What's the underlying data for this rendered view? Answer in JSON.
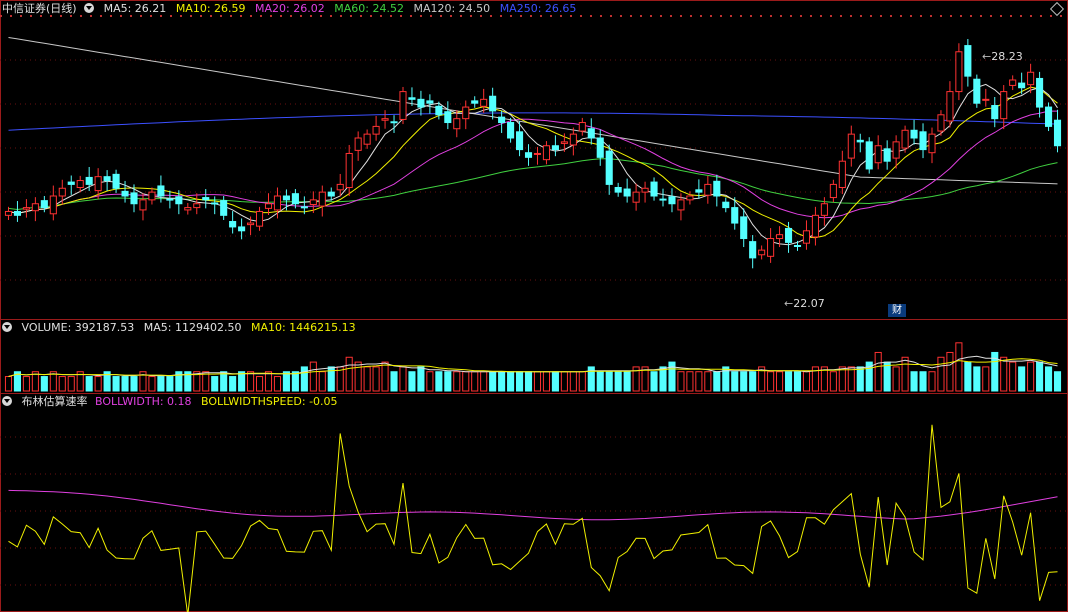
{
  "main_panel": {
    "title": "中信证券(日线)",
    "ma_labels": [
      {
        "text": "MA5: 26.21",
        "color": "#e0e0e0"
      },
      {
        "text": "MA10: 26.59",
        "color": "#f0f000"
      },
      {
        "text": "MA20: 26.02",
        "color": "#e040e0"
      },
      {
        "text": "MA60: 24.52",
        "color": "#40d040"
      },
      {
        "text": "MA120: 24.50",
        "color": "#c8c8c8"
      },
      {
        "text": "MA250: 26.65",
        "color": "#3c50ff"
      }
    ],
    "high_label": "28.23",
    "low_label": "22.07",
    "event_badge": "财"
  },
  "volume_panel": {
    "labels": [
      {
        "text": "VOLUME: 392187.53",
        "color": "#e0e0e0"
      },
      {
        "text": "MA5: 1129402.50",
        "color": "#e0e0e0"
      },
      {
        "text": "MA10: 1446215.13",
        "color": "#f0f000"
      }
    ]
  },
  "indicator_panel": {
    "title": "布林估算速率",
    "labels": [
      {
        "text": "BOLLWIDTH: 0.18",
        "color": "#e040e0"
      },
      {
        "text": "BOLLWIDTHSPEED: -0.05",
        "color": "#f0f000"
      }
    ]
  },
  "colors": {
    "up": "#ff3232",
    "down": "#54ffff",
    "border": "#9b1b1b",
    "ma5": "#e0e0e0",
    "ma10": "#f0f000",
    "ma20": "#e040e0",
    "ma60": "#40d040",
    "ma120": "#c8c8c8",
    "ma250": "#3c50ff"
  },
  "chart_data": [
    {
      "type": "candlestick",
      "title": "中信证券(日线)",
      "x": "trading days (unlabeled)",
      "ylim": [
        21.5,
        29.0
      ],
      "high": 28.23,
      "low": 22.07,
      "close_series": [
        24.1,
        24.0,
        24.2,
        24.3,
        24.2,
        24.5,
        24.7,
        24.8,
        24.9,
        24.8,
        25.0,
        24.9,
        24.7,
        24.5,
        24.3,
        24.4,
        24.6,
        24.5,
        24.4,
        24.3,
        24.2,
        24.3,
        24.4,
        24.3,
        24.0,
        23.7,
        23.6,
        23.8,
        24.1,
        24.3,
        24.5,
        24.4,
        24.3,
        24.2,
        24.4,
        24.6,
        24.5,
        24.8,
        25.6,
        26.0,
        26.1,
        26.3,
        26.5,
        26.4,
        27.2,
        27.0,
        26.8,
        26.9,
        26.6,
        26.4,
        26.5,
        26.8,
        26.9,
        27.0,
        26.7,
        26.4,
        26.0,
        25.7,
        25.5,
        25.6,
        25.8,
        25.7,
        25.9,
        26.1,
        26.4,
        26.0,
        25.5,
        24.8,
        24.6,
        24.5,
        24.6,
        24.7,
        24.5,
        24.4,
        24.3,
        24.4,
        24.5,
        24.6,
        24.8,
        24.5,
        24.2,
        23.8,
        23.4,
        22.9,
        23.1,
        23.4,
        23.5,
        23.3,
        23.2,
        23.6,
        24.0,
        24.3,
        24.8,
        25.4,
        26.1,
        25.9,
        25.2,
        25.8,
        25.4,
        25.9,
        26.2,
        26.0,
        25.7,
        26.1,
        26.6,
        27.2,
        28.23,
        27.6,
        26.9,
        27.0,
        26.5,
        27.2,
        27.5,
        27.3,
        27.7,
        26.8,
        26.3,
        25.8
      ],
      "ma": {
        "MA5": 26.21,
        "MA10": 26.59,
        "MA20": 26.02,
        "MA60": 24.52,
        "MA120": 24.5,
        "MA250": 26.65
      }
    },
    {
      "type": "bar",
      "title": "VOLUME",
      "values": [
        3,
        4,
        3,
        4,
        3,
        4,
        3,
        3,
        4,
        3,
        3,
        4,
        3,
        3,
        3,
        4,
        3,
        3,
        3,
        4,
        4,
        4,
        4,
        3,
        4,
        3,
        4,
        4,
        3,
        4,
        3,
        4,
        4,
        5,
        6,
        4,
        5,
        5,
        7,
        6,
        5,
        5,
        6,
        4,
        5,
        4,
        5,
        4,
        4,
        4,
        4,
        4,
        4,
        4,
        4,
        4,
        4,
        4,
        4,
        4,
        4,
        4,
        4,
        4,
        4,
        5,
        4,
        4,
        4,
        4,
        5,
        5,
        4,
        5,
        6,
        4,
        4,
        4,
        4,
        4,
        5,
        4,
        4,
        4,
        5,
        4,
        4,
        4,
        4,
        4,
        5,
        5,
        4,
        5,
        5,
        5,
        6,
        8,
        6,
        5,
        7,
        4,
        4,
        4,
        7,
        8,
        10,
        6,
        5,
        5,
        8,
        7,
        6,
        5,
        6,
        6,
        5,
        4
      ],
      "latest": 392187.53,
      "MA5": 1129402.5,
      "MA10": 1446215.13
    },
    {
      "type": "line",
      "title": "布林估算速率",
      "series": [
        {
          "name": "BOLLWIDTH",
          "latest": 0.18
        },
        {
          "name": "BOLLWIDTHSPEED",
          "latest": -0.05
        }
      ]
    }
  ]
}
